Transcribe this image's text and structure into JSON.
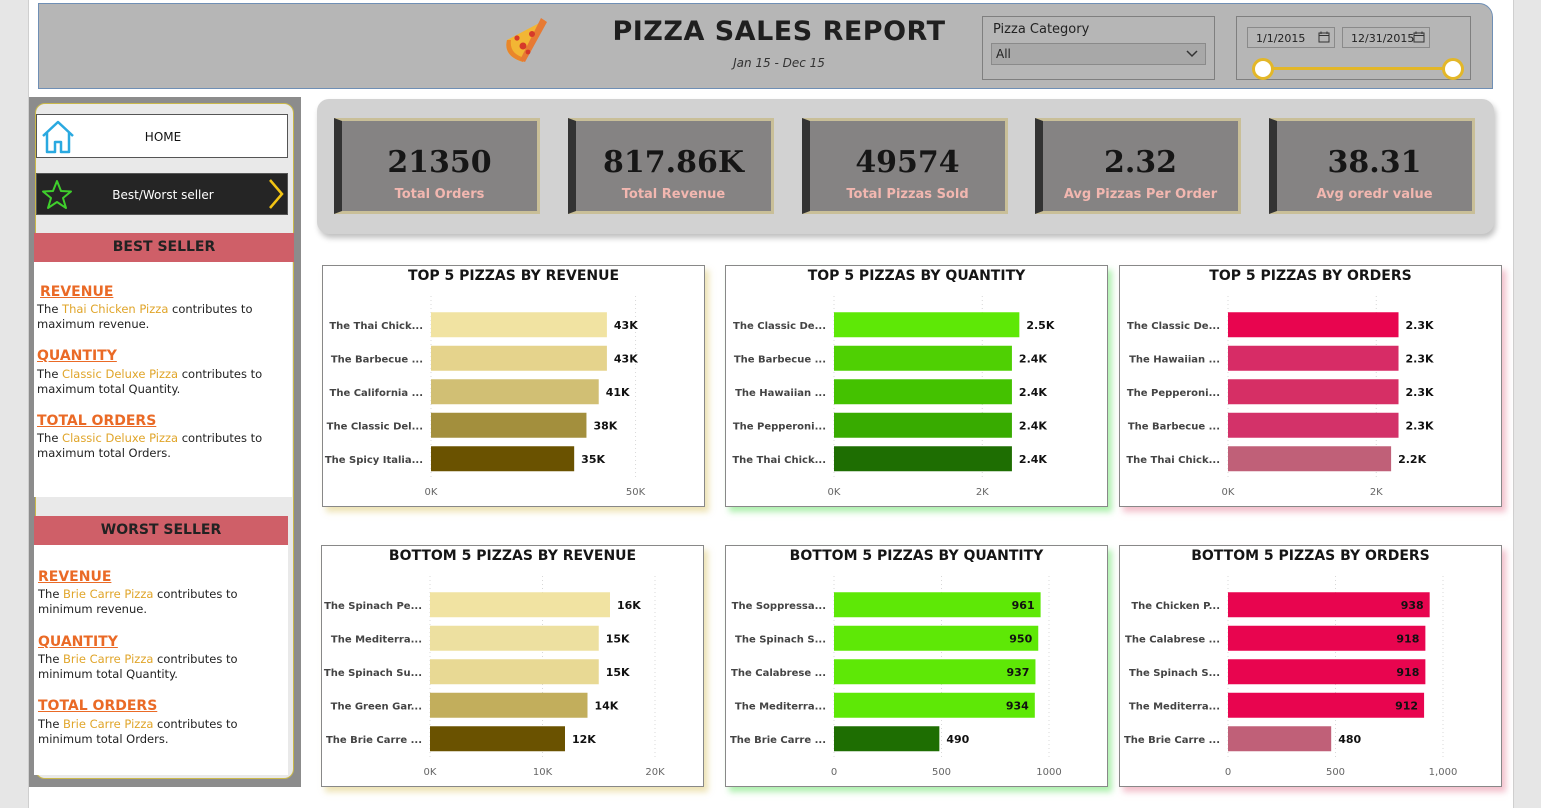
{
  "header": {
    "title": "PIZZA SALES REPORT",
    "subtitle": "Jan 15 - Dec 15",
    "category_label": "Pizza Category",
    "category_value": "All",
    "date_start": "1/1/2015",
    "date_end": "12/31/2015",
    "date_range_fraction": [
      0.0,
      1.0
    ]
  },
  "nav": {
    "home_label": "HOME",
    "bw_label": "Best/Worst seller"
  },
  "best": {
    "heading": "BEST SELLER",
    "items": [
      {
        "title": "REVENUE",
        "pre": "The ",
        "pizza": "Thai Chicken Pizza",
        "post": " contributes to maximum revenue."
      },
      {
        "title": "QUANTITY",
        "pre": "The ",
        "pizza": "Classic Deluxe Pizza",
        "post": " contributes to maximum total Quantity."
      },
      {
        "title": "TOTAL ORDERS",
        "pre": "The ",
        "pizza": "Classic Deluxe Pizza",
        "post": " contributes to maximum total Orders."
      }
    ]
  },
  "worst": {
    "heading": "WORST SELLER",
    "items": [
      {
        "title": "REVENUE",
        "pre": "The  ",
        "pizza": "Brie Carre Pizza",
        "post": " contributes to minimum revenue."
      },
      {
        "title": "QUANTITY",
        "pre": "The  ",
        "pizza": "Brie Carre Pizza",
        "post": " contributes to minimum total Quantity."
      },
      {
        "title": "TOTAL ORDERS",
        "pre": " The ",
        "pizza": "Brie Carre Pizza",
        "post": " contributes to minimum total Orders."
      }
    ]
  },
  "kpis": [
    {
      "value": "21350",
      "label": "Total Orders"
    },
    {
      "value": "817.86K",
      "label": "Total Revenue"
    },
    {
      "value": "49574",
      "label": "Total Pizzas Sold"
    },
    {
      "value": "2.32",
      "label": "Avg Pizzas Per Order"
    },
    {
      "value": "38.31",
      "label": "Avg oredr value"
    }
  ],
  "chart_data": [
    {
      "type": "bar",
      "orientation": "horizontal",
      "title": "TOP 5 PIZZAS BY REVENUE",
      "categories": [
        "The Thai Chick...",
        "The Barbecue ...",
        "The California ...",
        "The Classic Del...",
        "The Spicy Italia..."
      ],
      "values": [
        43000,
        43000,
        41000,
        38000,
        35000
      ],
      "value_labels": [
        "43K",
        "43K",
        "41K",
        "38K",
        "35K"
      ],
      "xlim": [
        0,
        55000
      ],
      "ticks": [
        {
          "v": 0,
          "label": "0K"
        },
        {
          "v": 50000,
          "label": "50K"
        }
      ],
      "colors": [
        "#f1e3a2",
        "#e5d38c",
        "#d1bf74",
        "#a38f3d",
        "#6a5200"
      ],
      "label_inside": false
    },
    {
      "type": "bar",
      "orientation": "horizontal",
      "title": "TOP 5 PIZZAS BY QUANTITY",
      "categories": [
        "The Classic De...",
        "The Barbecue ...",
        "The Hawaiian ...",
        "The Pepperoni...",
        "The Thai Chick..."
      ],
      "values": [
        2500,
        2400,
        2400,
        2400,
        2400
      ],
      "value_labels": [
        "2.5K",
        "2.4K",
        "2.4K",
        "2.4K",
        "2.4K"
      ],
      "xlim": [
        0,
        2900
      ],
      "ticks": [
        {
          "v": 0,
          "label": "0K"
        },
        {
          "v": 2000,
          "label": "2K"
        }
      ],
      "colors": [
        "#5ee806",
        "#4fd003",
        "#44c200",
        "#38ab00",
        "#1e6e02"
      ],
      "label_inside": false
    },
    {
      "type": "bar",
      "orientation": "horizontal",
      "title": "TOP 5 PIZZAS BY ORDERS",
      "categories": [
        "The Classic De...",
        "The Hawaiian ...",
        "The Pepperoni...",
        "The Barbecue ...",
        "The Thai Chick..."
      ],
      "values": [
        2300,
        2300,
        2300,
        2300,
        2200
      ],
      "value_labels": [
        "2.3K",
        "2.3K",
        "2.3K",
        "2.3K",
        "2.2K"
      ],
      "xlim": [
        0,
        2900
      ],
      "ticks": [
        {
          "v": 0,
          "label": "0K"
        },
        {
          "v": 2000,
          "label": "2K"
        }
      ],
      "colors": [
        "#e8054f",
        "#d72c66",
        "#d62f65",
        "#d33269",
        "#c06078"
      ],
      "label_inside": false
    },
    {
      "type": "bar",
      "orientation": "horizontal",
      "title": "BOTTOM 5 PIZZAS BY REVENUE",
      "categories": [
        "The Spinach Pe...",
        "The Mediterra...",
        "The Spinach Su...",
        "The Green Gar...",
        "The Brie Carre ..."
      ],
      "values": [
        16000,
        15000,
        15000,
        14000,
        12000
      ],
      "value_labels": [
        "16K",
        "15K",
        "15K",
        "14K",
        "12K"
      ],
      "xlim": [
        0,
        20000
      ],
      "ticks": [
        {
          "v": 0,
          "label": "0K"
        },
        {
          "v": 10000,
          "label": "10K"
        },
        {
          "v": 20000,
          "label": "20K"
        }
      ],
      "colors": [
        "#f1e3a2",
        "#ede0a0",
        "#e8d994",
        "#c2ae5c",
        "#6a5200"
      ],
      "label_inside": false
    },
    {
      "type": "bar",
      "orientation": "horizontal",
      "title": "BOTTOM 5 PIZZAS BY QUANTITY",
      "categories": [
        "The Soppressa...",
        "The Spinach S...",
        "The Calabrese ...",
        "The Mediterra...",
        "The Brie Carre ..."
      ],
      "values": [
        961,
        950,
        937,
        934,
        490
      ],
      "value_labels": [
        "961",
        "950",
        "937",
        "934",
        "490"
      ],
      "xlim": [
        0,
        1000
      ],
      "ticks": [
        {
          "v": 0,
          "label": "0"
        },
        {
          "v": 500,
          "label": "500"
        },
        {
          "v": 1000,
          "label": "1000"
        }
      ],
      "colors": [
        "#5ee806",
        "#5ee806",
        "#5ee806",
        "#5ee806",
        "#1e6e02"
      ],
      "label_inside": true
    },
    {
      "type": "bar",
      "orientation": "horizontal",
      "title": "BOTTOM 5 PIZZAS BY ORDERS",
      "categories": [
        "The Chicken P...",
        "The Calabrese ...",
        "The Spinach S...",
        "The Mediterra...",
        "The Brie Carre ..."
      ],
      "values": [
        938,
        918,
        918,
        912,
        480
      ],
      "value_labels": [
        "938",
        "918",
        "918",
        "912",
        "480"
      ],
      "xlim": [
        0,
        1000
      ],
      "ticks": [
        {
          "v": 0,
          "label": "0"
        },
        {
          "v": 500,
          "label": "500"
        },
        {
          "v": 1000,
          "label": "1,000"
        }
      ],
      "colors": [
        "#e8054f",
        "#e8054f",
        "#e8054f",
        "#e8054f",
        "#c06078"
      ],
      "label_inside": true
    }
  ]
}
